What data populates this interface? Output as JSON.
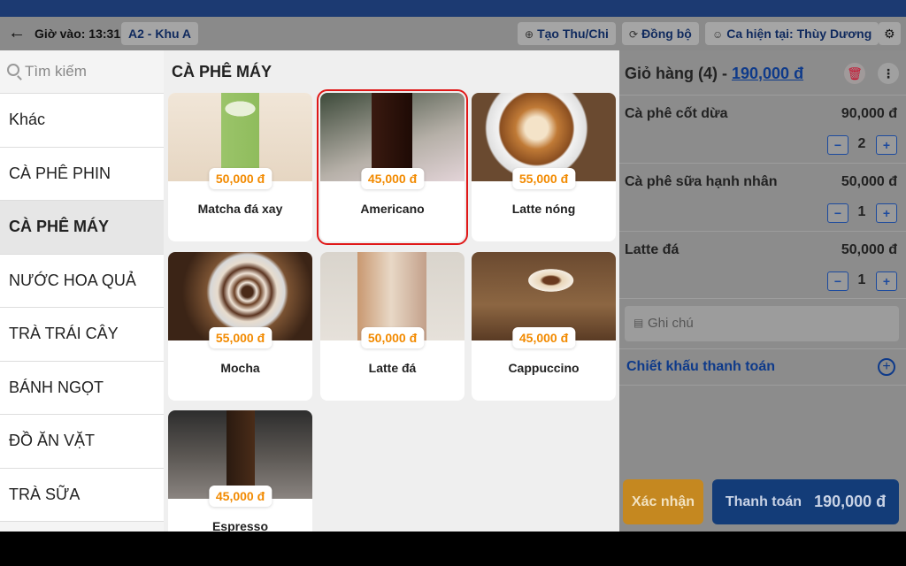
{
  "header": {
    "time_label": "Giờ vào: 13:31",
    "table_chip": "A2 - Khu A",
    "create_btn": "Tạo Thu/Chi",
    "sync_btn": "Đồng bộ",
    "shift_btn": "Ca hiện tại: Thùy Dương"
  },
  "sidebar": {
    "search_placeholder": "Tìm kiếm",
    "categories": [
      "Khác",
      "CÀ PHÊ PHIN",
      "CÀ PHÊ MÁY",
      "NƯỚC HOA QUẢ",
      "TRÀ TRÁI CÂY",
      "BÁNH NGỌT",
      "ĐỒ ĂN VẶT",
      "TRÀ SỮA"
    ],
    "active_index": 2
  },
  "main": {
    "title": "CÀ PHÊ MÁY",
    "products": [
      {
        "name": "Matcha đá xay",
        "price": "50,000 đ"
      },
      {
        "name": "Americano",
        "price": "45,000 đ"
      },
      {
        "name": "Latte nóng",
        "price": "55,000 đ"
      },
      {
        "name": "Mocha",
        "price": "55,000 đ"
      },
      {
        "name": "Latte đá",
        "price": "50,000 đ"
      },
      {
        "name": "Cappuccino",
        "price": "45,000 đ"
      },
      {
        "name": "Espresso",
        "price": "45,000 đ"
      }
    ]
  },
  "cart": {
    "title": "Giỏ hàng (4) - ",
    "total": "190,000 đ",
    "items": [
      {
        "name": "Cà phê cốt dừa",
        "price": "90,000 đ",
        "qty": "2"
      },
      {
        "name": "Cà phê sữa hạnh nhân",
        "price": "50,000 đ",
        "qty": "1"
      },
      {
        "name": "Latte đá",
        "price": "50,000 đ",
        "qty": "1"
      }
    ],
    "note_placeholder": "Ghi chú",
    "discount_label": "Chiết khấu thanh toán",
    "confirm_label": "Xác nhận",
    "pay_label": "Thanh toán",
    "pay_amount": "190,000 đ"
  },
  "colors": {
    "accent": "#0e3a8a",
    "price": "#f28a00",
    "confirm": "#c58820",
    "pay": "#133c78",
    "selection": "#e01818"
  }
}
